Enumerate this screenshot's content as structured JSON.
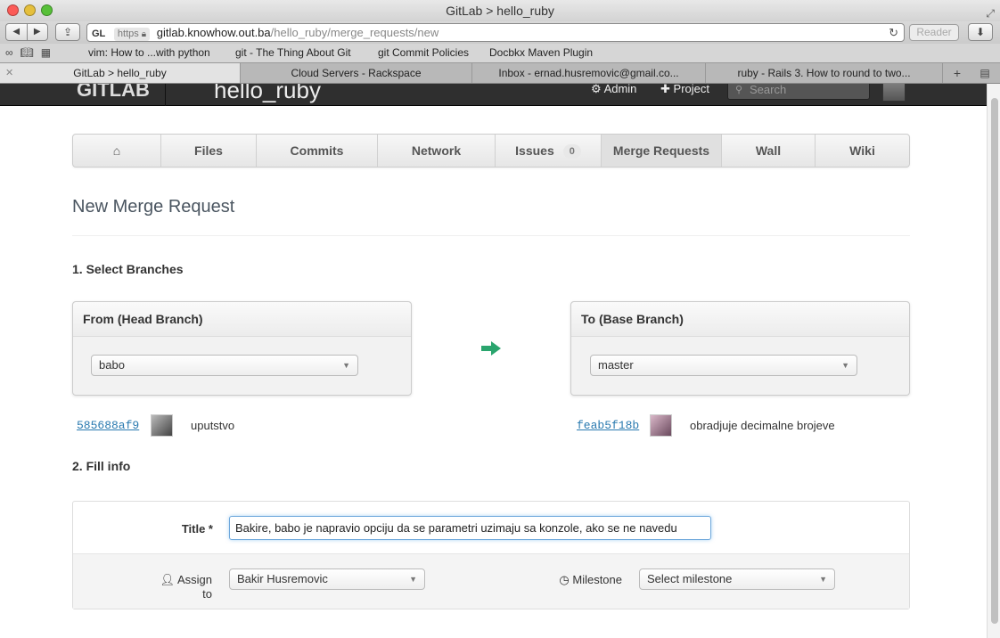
{
  "window": {
    "title": "GitLab > hello_ruby"
  },
  "toolbar": {
    "favicon": "GL",
    "https_label": "https",
    "url_host": "gitlab.knowhow.out.ba",
    "url_path": "/hello_ruby/merge_requests/new",
    "reader_label": "Reader"
  },
  "bookmarks": [
    "vim: How to ...with python",
    "git - The Thing About Git",
    "git Commit Policies",
    "Docbkx Maven Plugin"
  ],
  "tabs": [
    "GitLab > hello_ruby",
    "Cloud Servers - Rackspace",
    "Inbox - ernad.husremovic@gmail.co...",
    "ruby - Rails 3. How to round to two..."
  ],
  "header": {
    "logo": "GITLAB",
    "project": "hello_ruby",
    "admin": "Admin",
    "new_project": "Project",
    "search_placeholder": "Search"
  },
  "project_nav": {
    "files": "Files",
    "commits": "Commits",
    "network": "Network",
    "issues": "Issues",
    "issues_count": "0",
    "merge_requests": "Merge Requests",
    "wall": "Wall",
    "wiki": "Wiki"
  },
  "main": {
    "title": "New Merge Request",
    "step1": "1. Select Branches",
    "step2": "2. Fill info",
    "from": {
      "heading": "From (Head Branch)",
      "branch": "babo",
      "sha": "585688af9",
      "message": "uputstvo"
    },
    "to": {
      "heading": "To (Base Branch)",
      "branch": "master",
      "sha": "feab5f18b",
      "message": "obradjuje decimalne brojeve"
    },
    "form": {
      "title_label": "Title *",
      "title_value": "Bakire, babo je napravio opciju da se parametri uzimaju sa konzole, ako se ne navedu",
      "assign_label": "Assign to",
      "assign_value": "Bakir Husremovic",
      "milestone_label": "Milestone",
      "milestone_value": "Select milestone"
    }
  },
  "colors": {
    "arrow_green": "#2aa56e",
    "link_blue": "#2a7ab0",
    "header_dark": "#2f2f2f"
  }
}
